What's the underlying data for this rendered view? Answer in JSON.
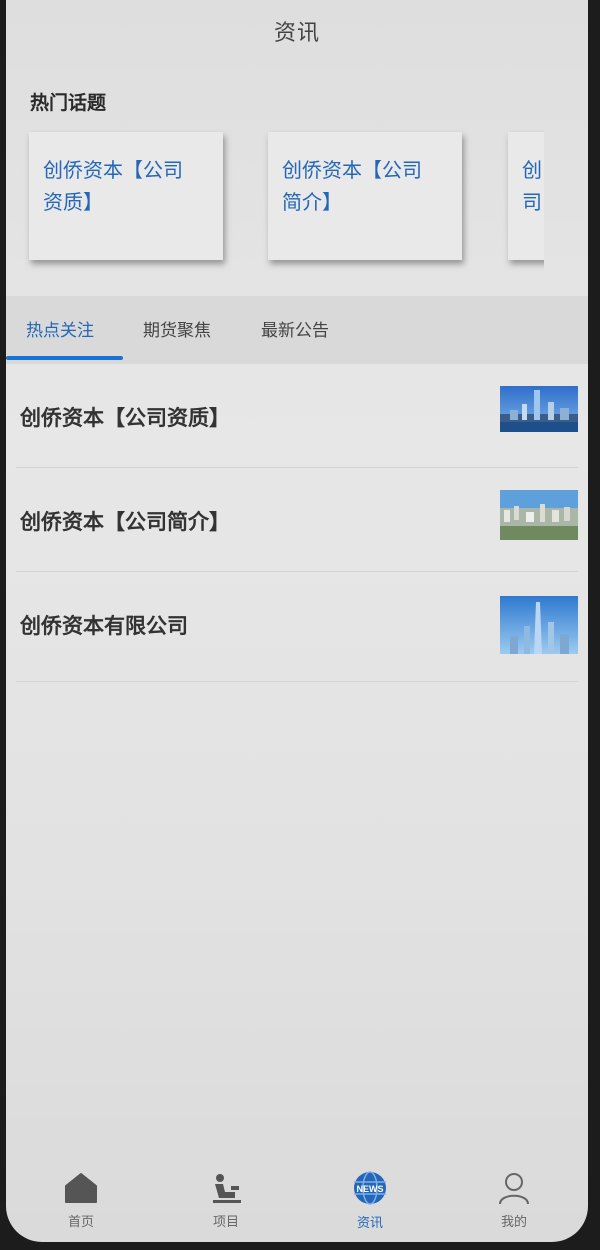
{
  "header": {
    "title": "资讯"
  },
  "hot_topics": {
    "label": "热门话题",
    "cards": [
      {
        "line1": "创侨资本【公司",
        "line2": "资质】"
      },
      {
        "line1": "创侨资本【公司",
        "line2": "简介】"
      },
      {
        "line1": "创",
        "line2": "司"
      }
    ]
  },
  "tabs": [
    {
      "label": "热点关注",
      "active": true
    },
    {
      "label": "期货聚焦",
      "active": false
    },
    {
      "label": "最新公告",
      "active": false
    }
  ],
  "news_list": [
    {
      "title": "创侨资本【公司资质】",
      "thumbnail": "city-skyline-photo"
    },
    {
      "title": "创侨资本【公司简介】",
      "thumbnail": "city-aerial-photo"
    },
    {
      "title": "创侨资本有限公司",
      "thumbnail": "skyscraper-photo"
    }
  ],
  "bottom_nav": [
    {
      "label": "首页",
      "icon": "home-icon",
      "active": false
    },
    {
      "label": "项目",
      "icon": "project-icon",
      "active": false
    },
    {
      "label": "资讯",
      "icon": "news-icon",
      "icon_text": "NEWS",
      "active": true
    },
    {
      "label": "我的",
      "icon": "user-icon",
      "active": false
    }
  ],
  "colors": {
    "accent": "#2466b8",
    "tab_indicator": "#1a72d4",
    "text": "#333333"
  }
}
